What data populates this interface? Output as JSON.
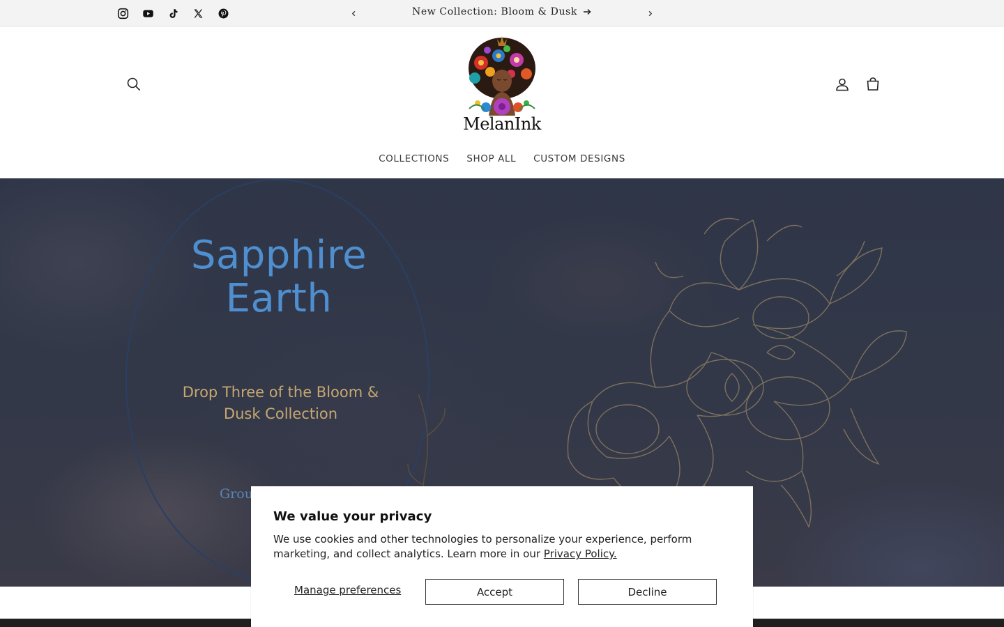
{
  "announcement": {
    "text": "New Collection: Bloom & Dusk",
    "social": [
      "instagram-icon",
      "youtube-icon",
      "tiktok-icon",
      "x-icon",
      "pinterest-icon"
    ]
  },
  "header": {
    "logo_text": "MelanInk",
    "nav": [
      "COLLECTIONS",
      "SHOP ALL",
      "CUSTOM DESIGNS"
    ]
  },
  "hero": {
    "title_line1": "Sapphire",
    "title_line2": "Earth",
    "subtitle_line1": "Drop Three of the Bloom &",
    "subtitle_line2": "Dusk Collection",
    "footer_partial": "Grou"
  },
  "cookie": {
    "title": "We value your privacy",
    "body": "We use cookies and other technologies to personalize your experience, perform marketing, and collect analytics. Learn more in our ",
    "policy_link": "Privacy Policy.",
    "manage_label": "Manage preferences",
    "accept_label": "Accept",
    "decline_label": "Decline"
  },
  "colors": {
    "hero_title": "#4f8fd0",
    "hero_subtitle": "#c7a870",
    "hero_bg": "#323848"
  }
}
